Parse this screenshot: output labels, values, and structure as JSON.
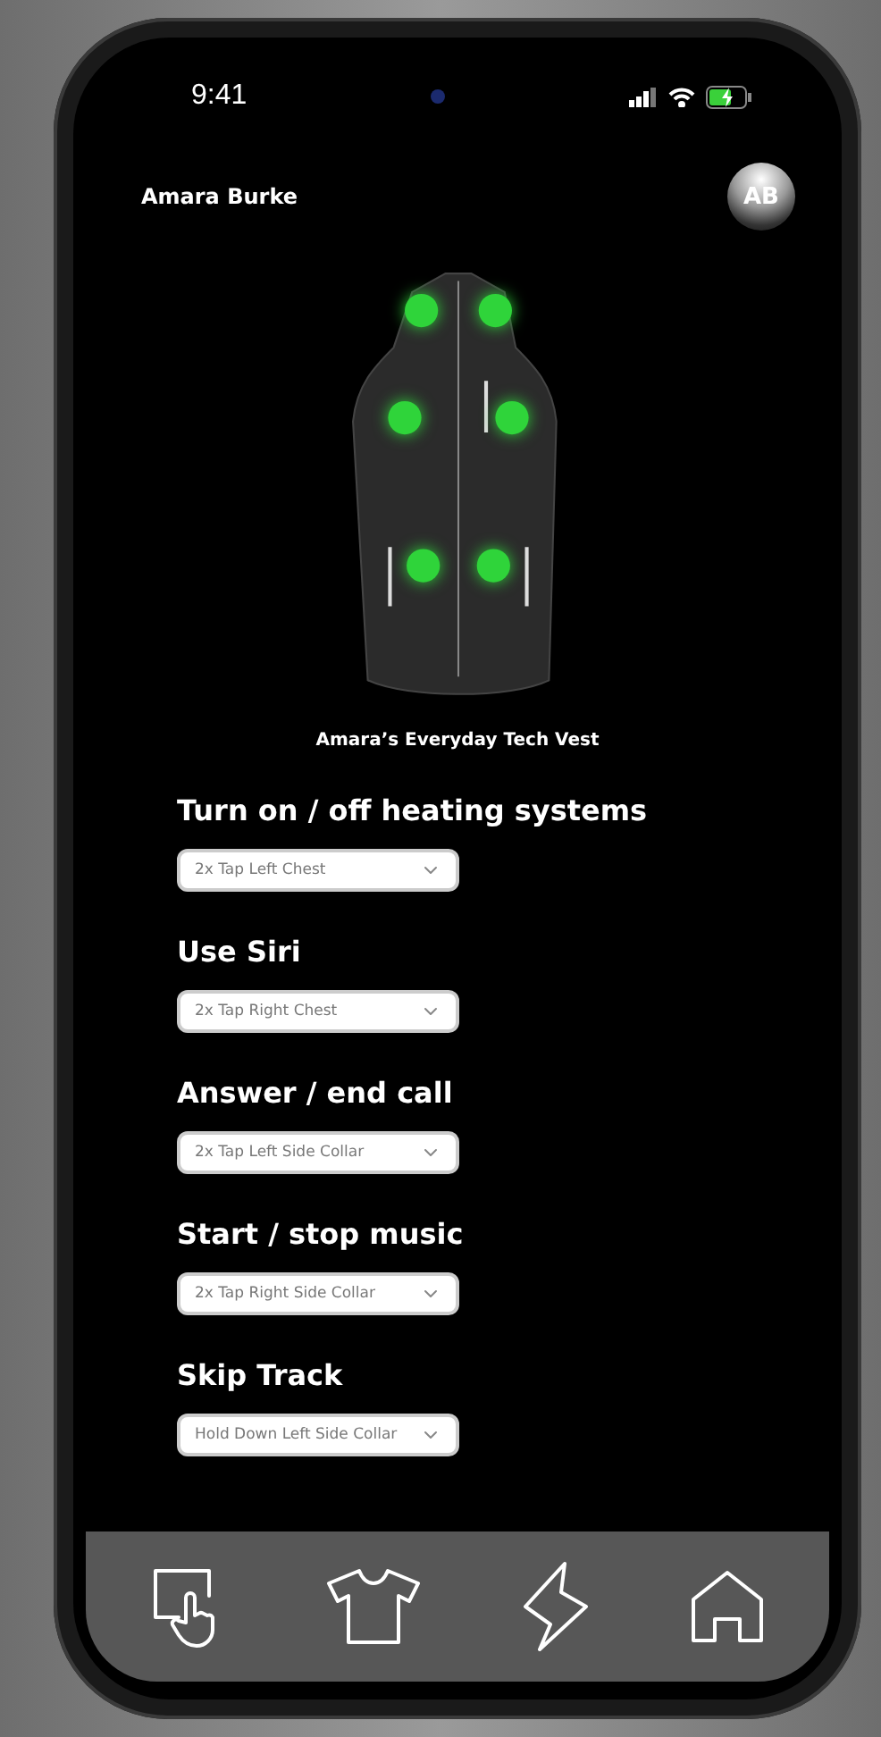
{
  "status_bar": {
    "time": "9:41"
  },
  "user": {
    "name": "Amara Burke",
    "initials": "AB"
  },
  "device": {
    "caption": "Amara’s Everyday Tech Vest"
  },
  "gestures": [
    {
      "action": "Turn on / off heating systems",
      "trigger": "2x Tap Left Chest"
    },
    {
      "action": "Use Siri",
      "trigger": "2x Tap Right Chest"
    },
    {
      "action": "Answer / end call",
      "trigger": "2x Tap Left Side Collar"
    },
    {
      "action": "Start / stop music",
      "trigger": "2x Tap Right Side Collar"
    },
    {
      "action": "Skip Track",
      "trigger": "Hold Down Left Side Collar"
    }
  ],
  "nav_items": [
    {
      "kind": "touch"
    },
    {
      "kind": "shirt"
    },
    {
      "kind": "bolt"
    },
    {
      "kind": "home"
    }
  ]
}
